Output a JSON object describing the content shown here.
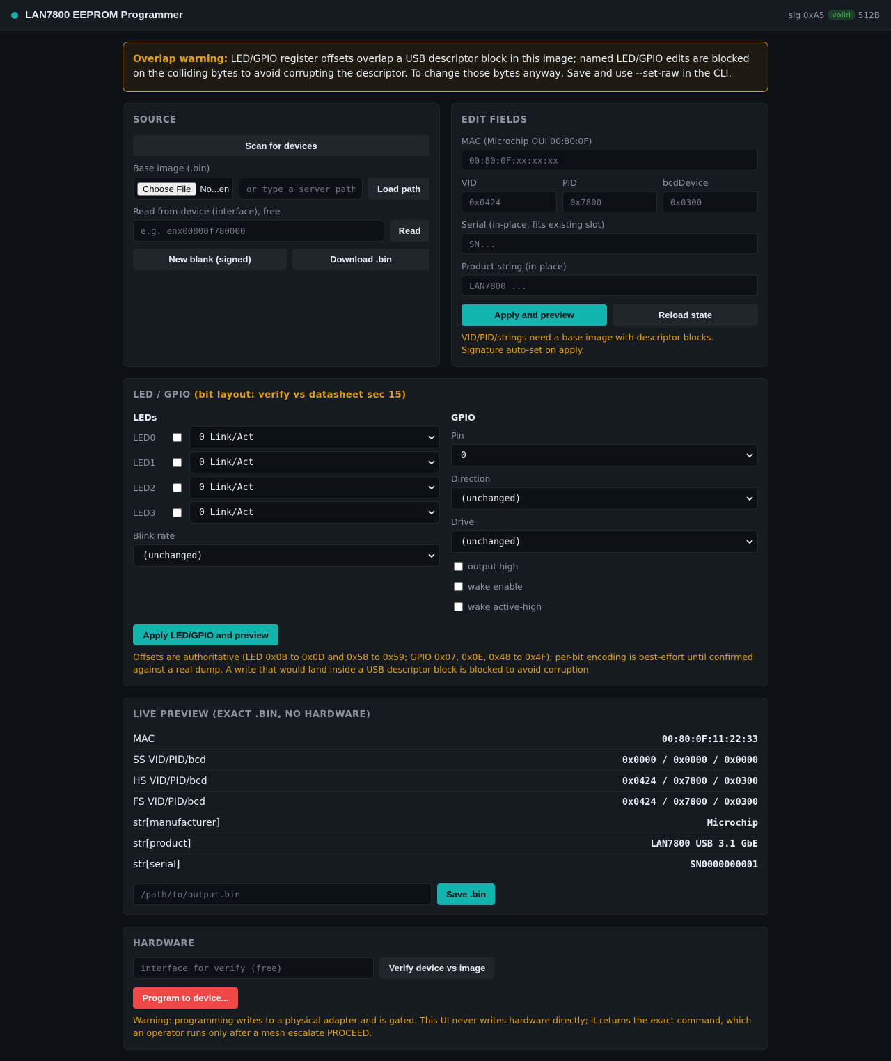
{
  "header": {
    "title": "LAN7800 EEPROM Programmer",
    "sig": "sig 0xA5",
    "status": "valid",
    "size": "512B"
  },
  "warning": {
    "label": "Overlap warning:",
    "text": " LED/GPIO register offsets overlap a USB descriptor block in this image; named LED/GPIO edits are blocked on the colliding bytes to avoid corrupting the descriptor. To change those bytes anyway, Save and use --set-raw in the CLI."
  },
  "source": {
    "title": "SOURCE",
    "scan_label": "Scan for devices",
    "base_image_label": "Base image (.bin)",
    "choose_file_label": "Choose File",
    "file_name": "No...en",
    "server_path_placeholder": "or type a server path",
    "load_path_label": "Load path",
    "read_label_text": "Read from device (interface), free",
    "read_placeholder": "e.g. enx00800f780000",
    "read_button": "Read",
    "new_blank_label": "New blank (signed)",
    "download_label": "Download .bin"
  },
  "edit": {
    "title": "EDIT FIELDS",
    "mac_label": "MAC (Microchip OUI 00:80:0F)",
    "mac_placeholder": "00:80:0F:xx:xx:xx",
    "vid_label": "VID",
    "vid_placeholder": "0x0424",
    "pid_label": "PID",
    "pid_placeholder": "0x7800",
    "bcd_label": "bcdDevice",
    "bcd_placeholder": "0x0300",
    "serial_label": "Serial (in-place, fits existing slot)",
    "serial_placeholder": "SN...",
    "product_label": "Product string (in-place)",
    "product_placeholder": "LAN7800 ...",
    "apply_label": "Apply and preview",
    "reload_label": "Reload state",
    "note": "VID/PID/strings need a base image with descriptor blocks. Signature auto-set on apply."
  },
  "led_gpio": {
    "title": "LED / GPIO",
    "title_note": "(bit layout: verify vs datasheet sec 15)",
    "leds_heading": "LEDs",
    "leds": [
      {
        "name": "LED0",
        "mode": "0 Link/Act"
      },
      {
        "name": "LED1",
        "mode": "0 Link/Act"
      },
      {
        "name": "LED2",
        "mode": "0 Link/Act"
      },
      {
        "name": "LED3",
        "mode": "0 Link/Act"
      }
    ],
    "blink_label": "Blink rate",
    "blink_value": "(unchanged)",
    "gpio_heading": "GPIO",
    "pin_label": "Pin",
    "pin_value": "0",
    "direction_label": "Direction",
    "direction_value": "(unchanged)",
    "drive_label": "Drive",
    "drive_value": "(unchanged)",
    "output_high": "output high",
    "wake_enable": "wake enable",
    "wake_active_high": "wake active-high",
    "apply_label": "Apply LED/GPIO and preview",
    "note": "Offsets are authoritative (LED 0x0B to 0x0D and 0x58 to 0x59; GPIO 0x07, 0x0E, 0x48 to 0x4F); per-bit encoding is best-effort until confirmed against a real dump. A write that would land inside a USB descriptor block is blocked to avoid corruption."
  },
  "preview": {
    "title": "LIVE PREVIEW (EXACT .BIN, NO HARDWARE)",
    "rows": [
      {
        "key": "MAC",
        "value": "00:80:0F:11:22:33"
      },
      {
        "key": "SS VID/PID/bcd",
        "value": "0x0000 / 0x0000 / 0x0000"
      },
      {
        "key": "HS VID/PID/bcd",
        "value": "0x0424 / 0x7800 / 0x0300"
      },
      {
        "key": "FS VID/PID/bcd",
        "value": "0x0424 / 0x7800 / 0x0300"
      },
      {
        "key": "str[manufacturer]",
        "value": "Microchip"
      },
      {
        "key": "str[product]",
        "value": "LAN7800 USB 3.1 GbE"
      },
      {
        "key": "str[serial]",
        "value": "SN0000000001"
      }
    ],
    "output_placeholder": "/path/to/output.bin",
    "save_label": "Save .bin"
  },
  "hardware": {
    "title": "HARDWARE",
    "iface_placeholder": "interface for verify (free)",
    "verify_label": "Verify device vs image",
    "program_label": "Program to device...",
    "note": "Warning: programming writes to a physical adapter and is gated. This UI never writes hardware directly; it returns the exact command, which an operator runs only after a mesh escalate PROCEED."
  },
  "colors": {
    "accent": "#12b5ad",
    "warning": "#e3a008",
    "danger": "#f04747",
    "ok": "#3fb950"
  }
}
